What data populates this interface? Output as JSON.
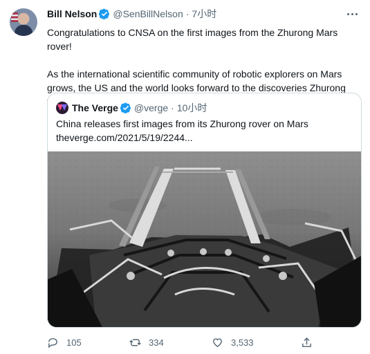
{
  "tweet": {
    "author_name": "Bill Nelson",
    "author_handle": "@SenBillNelson",
    "separator": "·",
    "time": "7小时",
    "text_line1": "Congratulations to CNSA on the first images from the Zhurong Mars rover!",
    "text_line2": "As the international scientific community of robotic explorers on Mars grows, the US and the world looks forward to the discoveries Zhurong will make to advance humanity's knowledge of the Red Planet."
  },
  "quote": {
    "author_name": "The Verge",
    "author_handle": "@verge",
    "separator": "·",
    "time": "10小时",
    "title": "China releases first images from its Zhurong rover on Mars",
    "url": "theverge.com/2021/5/19/2244..."
  },
  "actions": {
    "reply_count": "105",
    "retweet_count": "334",
    "like_count": "3,533"
  },
  "icons": {
    "verified": "verified-badge-icon",
    "more": "more-options-icon",
    "reply": "reply-icon",
    "retweet": "retweet-icon",
    "like": "heart-icon",
    "share": "share-icon"
  },
  "colors": {
    "verified": "#1d9bf0",
    "muted": "#536471",
    "border": "#cfd9de"
  }
}
